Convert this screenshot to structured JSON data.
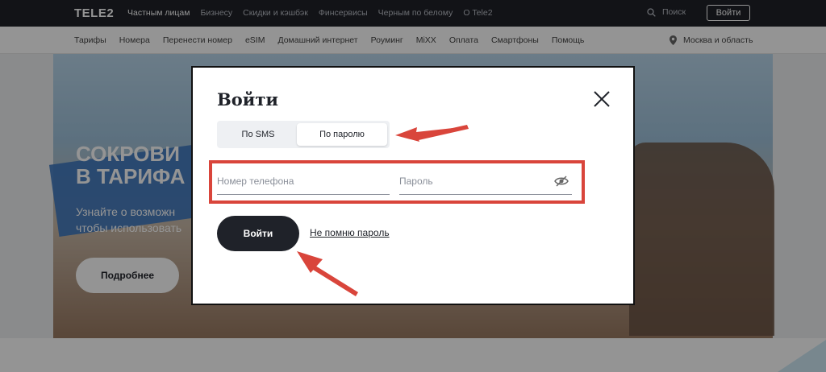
{
  "header": {
    "logo": "TELE2",
    "nav": [
      "Частным лицам",
      "Бизнесу",
      "Скидки и кэшбэк",
      "Финсервисы",
      "Черным по белому",
      "О Tele2"
    ],
    "search_label": "Поиск",
    "login_label": "Войти"
  },
  "subnav": {
    "items": [
      "Тарифы",
      "Номера",
      "Перенести номер",
      "eSIM",
      "Домашний интернет",
      "Роуминг",
      "MiXX",
      "Оплата",
      "Смартфоны",
      "Помощь"
    ],
    "region": "Москва и область"
  },
  "hero": {
    "title_line1": "СОКРОВИ",
    "title_line2": "В ТАРИФА",
    "text_line1": "Узнайте о возможн",
    "text_line2": "чтобы использовать",
    "button": "Подробнее"
  },
  "modal": {
    "title": "Войти",
    "tabs": [
      "По SMS",
      "По паролю"
    ],
    "active_tab": "По паролю",
    "phone_placeholder": "Номер телефона",
    "password_placeholder": "Пароль",
    "submit": "Войти",
    "forgot": "Не помню пароль"
  },
  "colors": {
    "dark": "#1f2229",
    "highlight": "#d9453b",
    "overlay": "rgba(0,0,0,0.42)"
  },
  "icons": [
    "search-icon",
    "location-icon",
    "close-icon",
    "eye-off-icon"
  ]
}
